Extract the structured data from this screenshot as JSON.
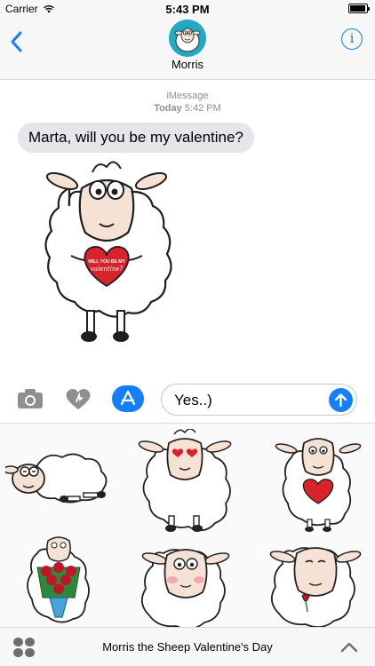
{
  "status_bar": {
    "carrier": "Carrier",
    "time": "5:43 PM",
    "battery_level": 0.92
  },
  "header": {
    "contact_name": "Morris",
    "back_icon": "chevron-left-icon",
    "info_icon": "info-icon",
    "info_label": "i"
  },
  "conversation": {
    "service": "iMessage",
    "day": "Today",
    "time": "5:42 PM",
    "received_message": "Marta, will you be my valentine?",
    "sticker_heart_text_top": "WILL YOU BE MY",
    "sticker_heart_text_bottom": "valentine?"
  },
  "input_bar": {
    "camera_icon": "camera-icon",
    "digital_touch_icon": "heart-touch-icon",
    "app_store_icon": "app-store-icon",
    "message_value": "Yes..)",
    "send_icon": "send-arrow-icon"
  },
  "sticker_drawer": {
    "stickers": [
      {
        "name": "sheep-lying-down"
      },
      {
        "name": "sheep-heart-eyes"
      },
      {
        "name": "sheep-holding-heart"
      },
      {
        "name": "sheep-with-roses"
      },
      {
        "name": "sheep-blushing"
      },
      {
        "name": "sheep-with-rose"
      }
    ]
  },
  "app_bar": {
    "apps_icon": "app-drawer-icon",
    "app_name": "Morris the Sheep Valentine's Day",
    "expand_icon": "chevron-up-icon"
  },
  "colors": {
    "accent": "#147efb",
    "bubble_received": "#e5e5ea",
    "heart_red": "#d8232a",
    "avatar_bg": "#22a9c4"
  }
}
